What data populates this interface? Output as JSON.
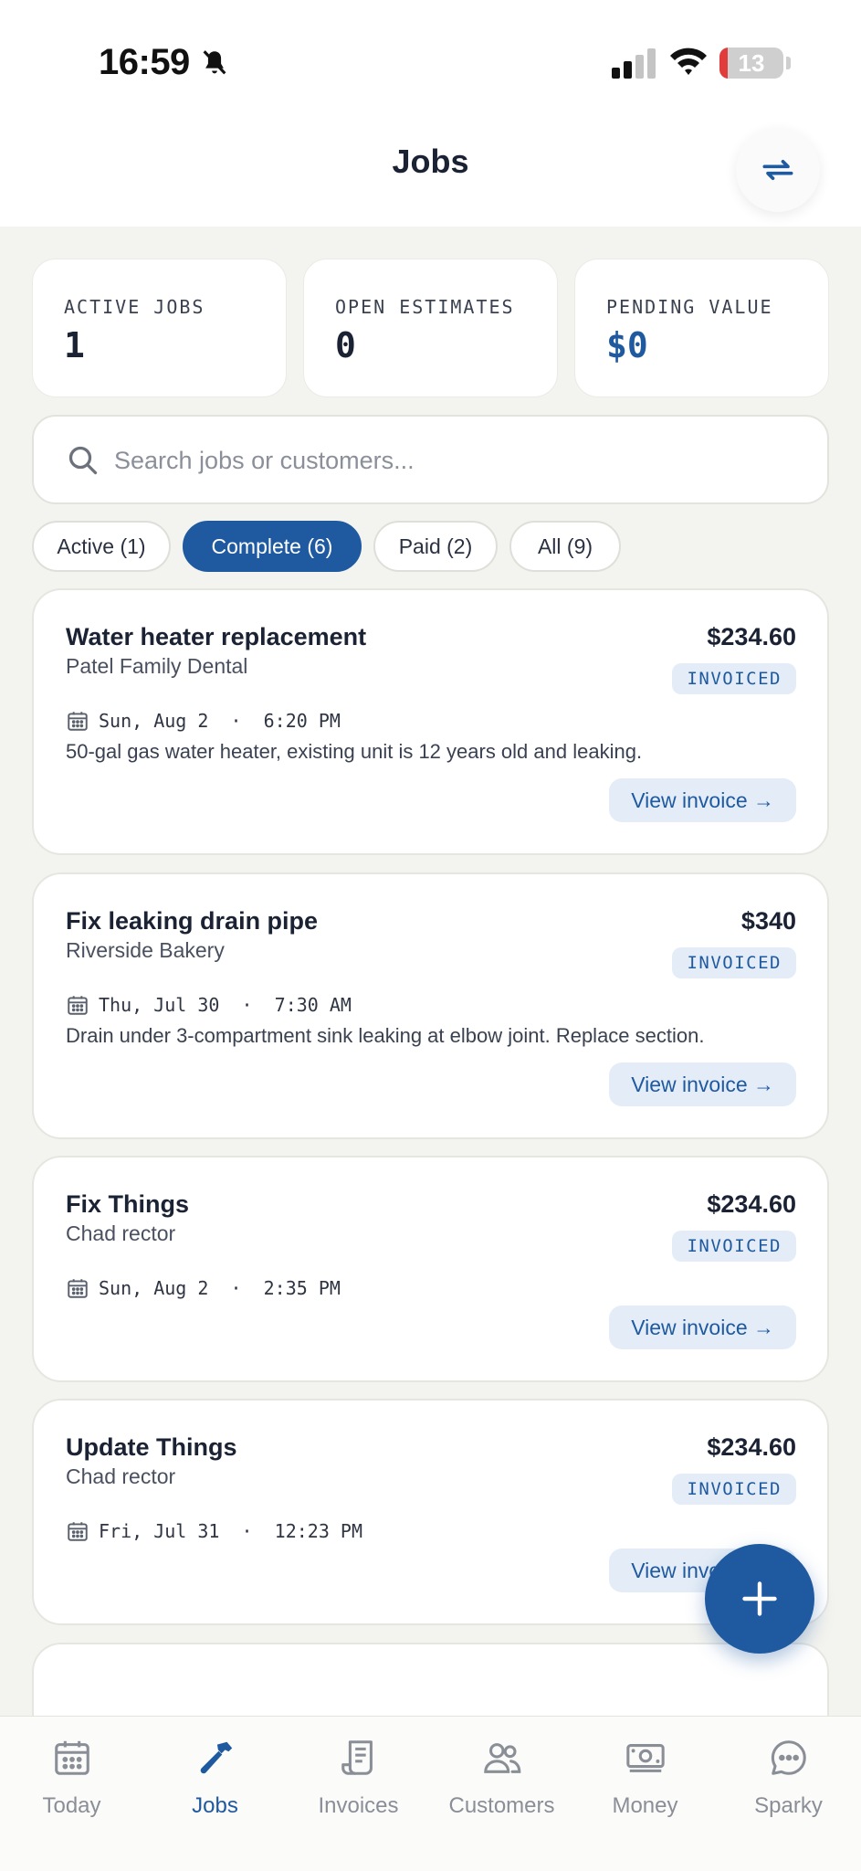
{
  "status_bar": {
    "time": "16:59",
    "battery": "13",
    "battery_level_percent": 13
  },
  "header": {
    "title": "Jobs",
    "sync_icon": "sync-icon"
  },
  "stats": [
    {
      "label": "ACTIVE JOBS",
      "value": "1"
    },
    {
      "label": "OPEN ESTIMATES",
      "value": "0"
    },
    {
      "label": "PENDING VALUE",
      "value": "$0",
      "color": "#1f5aa0"
    }
  ],
  "search": {
    "placeholder": "Search jobs or customers...",
    "value": ""
  },
  "filters": [
    {
      "label": "Active (1)",
      "selected": false
    },
    {
      "label": "Complete (6)",
      "selected": true
    },
    {
      "label": "Paid (2)",
      "selected": false
    },
    {
      "label": "All (9)",
      "selected": false
    }
  ],
  "jobs": [
    {
      "title": "Water heater replacement",
      "customer": "Patel Family Dental",
      "amount": "$234.60",
      "status": "INVOICED",
      "date": "Sun, Aug 2  ·  6:20 PM",
      "notes": "50-gal gas water heater, existing unit is 12 years old and leaking.",
      "action": "View invoice →"
    },
    {
      "title": "Fix leaking drain pipe",
      "customer": "Riverside Bakery",
      "amount": "$340",
      "status": "INVOICED",
      "date": "Thu, Jul 30  ·  7:30 AM",
      "notes": "Drain under 3-compartment sink leaking at elbow joint. Replace section.",
      "action": "View invoice →"
    },
    {
      "title": "Fix Things",
      "customer": "Chad rector",
      "amount": "$234.60",
      "status": "INVOICED",
      "date": "Sun, Aug 2  ·  2:35 PM",
      "notes": "",
      "action": "View invoice →"
    },
    {
      "title": "Update Things",
      "customer": "Chad rector",
      "amount": "$234.60",
      "status": "INVOICED",
      "date": "Fri, Jul 31  ·  12:23 PM",
      "notes": "",
      "action": "View invoice →"
    }
  ],
  "fab": {
    "icon": "plus-icon"
  },
  "nav": [
    {
      "label": "Today",
      "icon": "calendar-icon",
      "active": false
    },
    {
      "label": "Jobs",
      "icon": "hammer-icon",
      "active": true
    },
    {
      "label": "Invoices",
      "icon": "receipt-icon",
      "active": false
    },
    {
      "label": "Customers",
      "icon": "people-icon",
      "active": false
    },
    {
      "label": "Money",
      "icon": "cash-icon",
      "active": false
    },
    {
      "label": "Sparky",
      "icon": "chat-icon",
      "active": false
    }
  ],
  "colors": {
    "primary": "#1f5aa0",
    "badge_bg": "#e4edf7",
    "background": "#f3f3ef"
  }
}
